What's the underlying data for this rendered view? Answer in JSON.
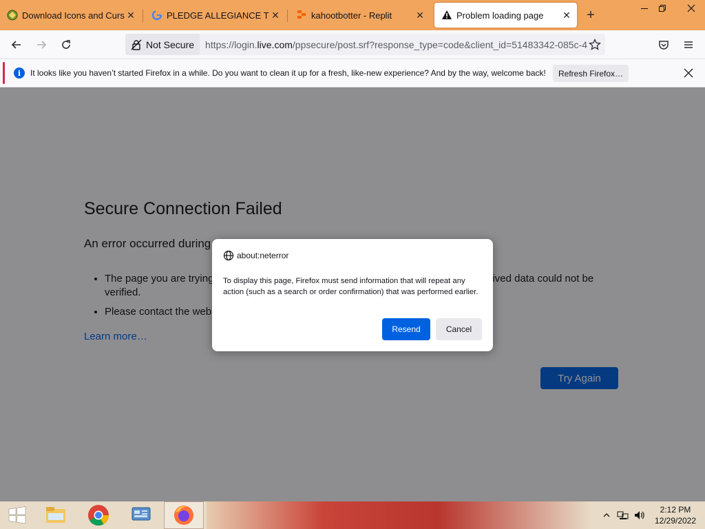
{
  "tabs": [
    {
      "title": "Download Icons and Cursors",
      "icon": "custom-favicon"
    },
    {
      "title": "PLEDGE ALLEGIANCE TO AN",
      "icon": "google-g-icon"
    },
    {
      "title": "kahootbotter - Replit",
      "icon": "replit-icon"
    },
    {
      "title": "Problem loading page",
      "icon": "warning-icon",
      "active": true
    }
  ],
  "urlbar": {
    "security_label": "Not Secure",
    "url_prefix": "https://login.",
    "url_host": "live.com",
    "url_path": "/ppsecure/post.srf?response_type=code&client_id=51483342-085c-4"
  },
  "notification": {
    "message": "It looks like you haven’t started Firefox in a while. Do you want to clean it up for a fresh, like-new experience? And by the way, welcome back!",
    "button_label": "Refresh Firefox…"
  },
  "error_page": {
    "title": "Secure Connection Failed",
    "intro": "An error occurred during",
    "bullets": [
      "The page you are trying ... ived data could not be verified.",
      "Please contact the webs"
    ],
    "bullet1_a": "The page you are trying",
    "bullet1_b": "ived data could not be",
    "bullet1_c": "verified.",
    "bullet2": "Please contact the webs",
    "learn_more": "Learn more…",
    "try_again": "Try Again"
  },
  "dialog": {
    "origin": "about:neterror",
    "message": "To display this page, Firefox must send information that will repeat any action (such as a search or order confirmation) that was performed earlier.",
    "primary_button": "Resend",
    "secondary_button": "Cancel"
  },
  "taskbar": {
    "time": "2:12 PM",
    "date": "12/29/2022"
  },
  "colors": {
    "tabstrip": "#f2a55c",
    "accent_blue": "#0061e0",
    "notification_accent": "#d7264e"
  }
}
